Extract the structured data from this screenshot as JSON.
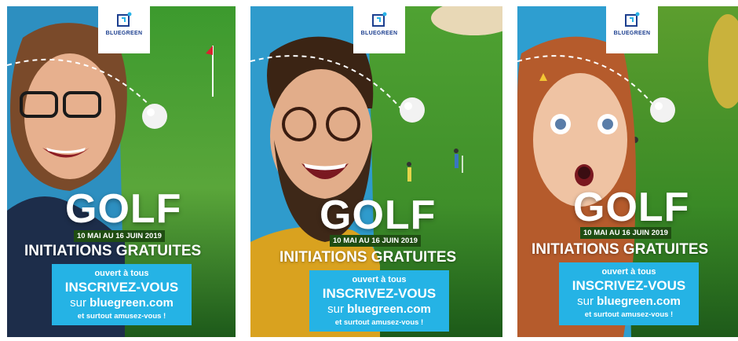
{
  "brand": {
    "logo_text": "BLUEGREEN"
  },
  "colors": {
    "sky": "#2c9fd1",
    "grass_light": "#4f9a2a",
    "grass_dark": "#1f6a1c",
    "cta": "#25b3e5",
    "dates_bg": "#1f4d12"
  },
  "posters": [
    {
      "subject": "woman with glasses",
      "headline": "GOLF",
      "dates": "10 MAI AU 16 JUIN 2019",
      "subtitle": "INITIATIONS GRATUITES",
      "cta": {
        "line1": "ouvert à tous",
        "line2": "INSCRIVEZ-VOUS",
        "line3_prefix": "sur ",
        "line3_site": "bluegreen.com",
        "line4": "et surtout amusez-vous !"
      }
    },
    {
      "subject": "bearded man with glasses",
      "headline": "GOLF",
      "dates": "10 MAI AU 16 JUIN 2019",
      "subtitle": "INITIATIONS GRATUITES",
      "cta": {
        "line1": "ouvert à tous",
        "line2": "INSCRIVEZ-VOUS",
        "line3_prefix": "sur ",
        "line3_site": "bluegreen.com",
        "line4": "et surtout amusez-vous !"
      }
    },
    {
      "subject": "surprised girl",
      "headline": "GOLF",
      "dates": "10 MAI AU 16 JUIN 2019",
      "subtitle": "INITIATIONS GRATUITES",
      "cta": {
        "line1": "ouvert à tous",
        "line2": "INSCRIVEZ-VOUS",
        "line3_prefix": "sur ",
        "line3_site": "bluegreen.com",
        "line4": "et surtout amusez-vous !"
      }
    }
  ]
}
